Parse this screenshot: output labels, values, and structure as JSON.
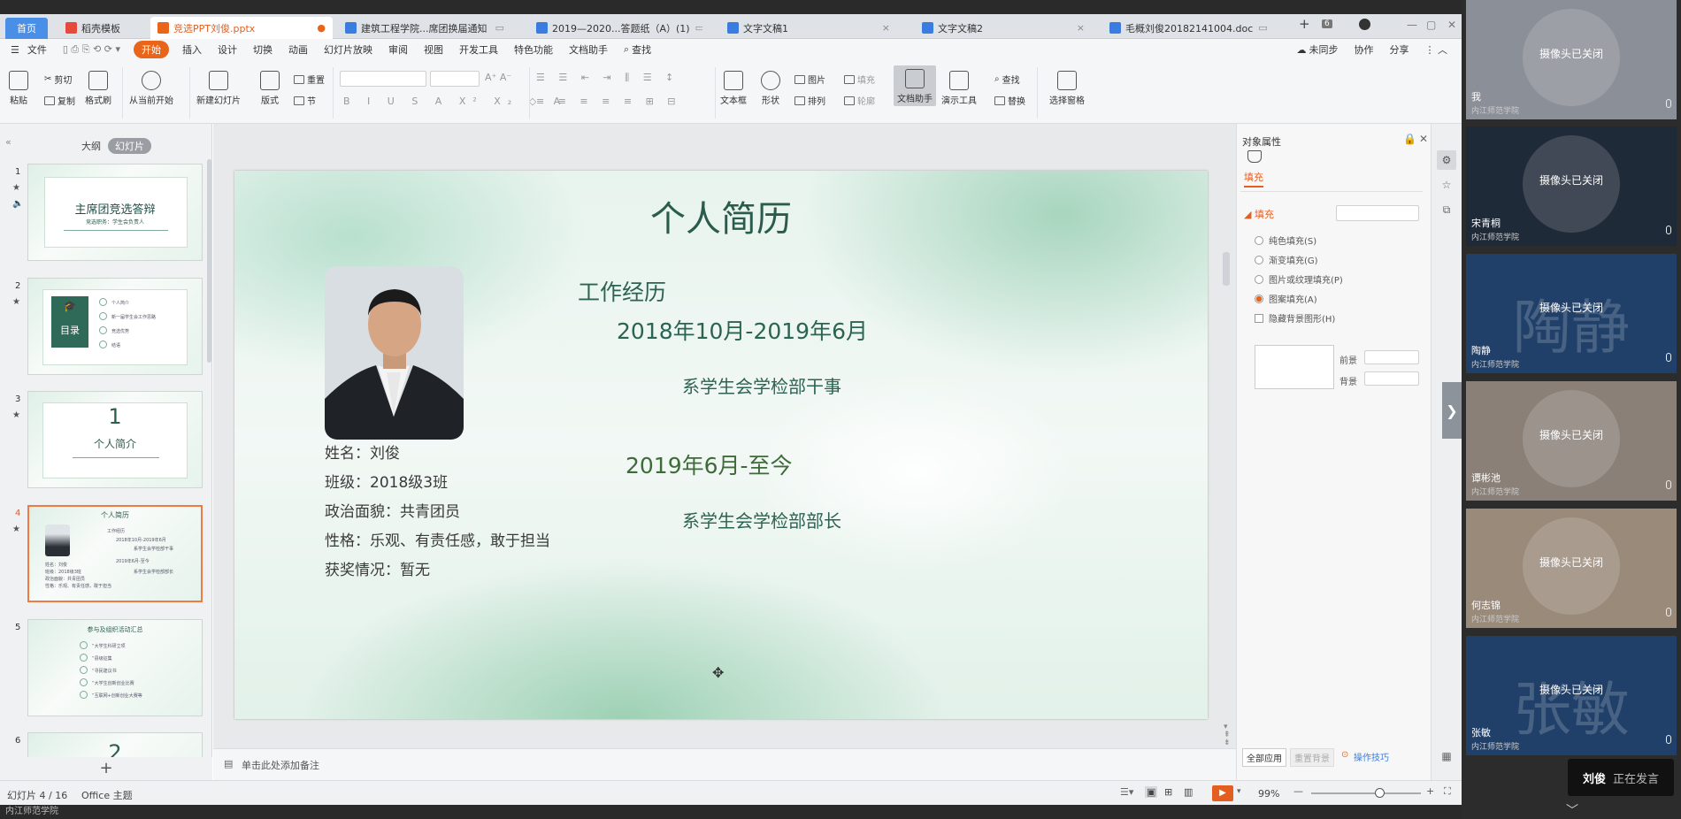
{
  "tabs": [
    {
      "label": "首页",
      "kind": "home"
    },
    {
      "label": "稻壳模板",
      "icon": "docer-icon",
      "color": "#e7493b"
    },
    {
      "label": "竞选PPT刘俊.pptx",
      "icon": "ppt-icon",
      "color": "#e8651a",
      "active": true
    },
    {
      "label": "建筑工程学院...席团换届通知",
      "icon": "word-icon",
      "color": "#3a7de0"
    },
    {
      "label": "2019—2020...答题纸（A）(1)",
      "icon": "word-icon",
      "color": "#3a7de0"
    },
    {
      "label": "文字文稿1",
      "icon": "word-icon",
      "color": "#3a7de0"
    },
    {
      "label": "文字文稿2",
      "icon": "word-icon",
      "color": "#3a7de0"
    },
    {
      "label": "毛概刘俊20182141004.doc",
      "icon": "word-icon",
      "color": "#3a7de0"
    }
  ],
  "tab_count_badge": "6",
  "menu": {
    "file": "文件",
    "items": [
      "开始",
      "插入",
      "设计",
      "切换",
      "动画",
      "幻灯片放映",
      "审阅",
      "视图",
      "开发工具",
      "特色功能",
      "文档助手"
    ],
    "active": "开始",
    "search": "查找",
    "sync": "未同步",
    "collab": "协作",
    "share": "分享"
  },
  "ribbon": {
    "paste": "粘贴",
    "cut": "剪切",
    "copy": "复制",
    "format_painter": "格式刷",
    "play_from": "从当前开始",
    "new_slide": "新建幻灯片",
    "layout": "版式",
    "section": "节",
    "reset": "重置",
    "textbox": "文本框",
    "shape": "形状",
    "picture": "图片",
    "fill": "填充",
    "arrange": "排列",
    "outline": "轮廓",
    "doc_helper": "文档助手",
    "present_tools": "演示工具",
    "find": "查找",
    "replace": "替换",
    "select_pane": "选择窗格"
  },
  "left_panel": {
    "tab_outline": "大纲",
    "tab_slides": "幻灯片",
    "thumbs": [
      {
        "num": "1",
        "title": "主席团竞选答辩",
        "sub": "竞选职务：学生会负责人"
      },
      {
        "num": "2",
        "title": "目录",
        "items": [
          "个人简介",
          "新一届学生会工作思路",
          "竞选优势",
          "结语"
        ]
      },
      {
        "num": "3",
        "title": "1",
        "sub": "个人简介"
      },
      {
        "num": "4",
        "title": "个人简历",
        "selected": true
      },
      {
        "num": "5",
        "title": "参与及组织活动汇总",
        "items": [
          "“大学生科研立项",
          "“县级征集",
          "“寻民建议书",
          "“大学生创新创业比赛",
          "“互联网+创新创业大赛等"
        ]
      },
      {
        "num": "6",
        "title": "2"
      }
    ],
    "add_label": "+"
  },
  "slide": {
    "title": "个人简历",
    "work_heading": "工作经历",
    "period1": "2018年10月-2019年6月",
    "role1": "系学生会学检部干事",
    "period2": "2019年6月-至今",
    "role2": "系学生会学检部部长",
    "info": [
      "姓名：刘俊",
      "班级：2018级3班",
      "政治面貌：共青团员",
      "性格：乐观、有责任感，敢于担当",
      "获奖情况：暂无"
    ]
  },
  "notes_placeholder": "单击此处添加备注",
  "right_panel": {
    "title": "对象属性",
    "tab": "填充",
    "section": "填充",
    "options": [
      {
        "label": "纯色填充(S)",
        "checked": false
      },
      {
        "label": "渐变填充(G)",
        "checked": false
      },
      {
        "label": "图片或纹理填充(P)",
        "checked": false
      },
      {
        "label": "图案填充(A)",
        "checked": true
      }
    ],
    "hide_bg": "隐藏背景图形(H)",
    "foreground": "前景",
    "background": "背景",
    "apply_all": "全部应用",
    "reset_bg": "重置背景",
    "tips": "操作技巧"
  },
  "status": {
    "slide_info": "幻灯片 4 / 16",
    "theme": "Office 主题",
    "zoom": "99%",
    "zoom_fraction": 0.62
  },
  "taskbar_text": "内江师范学院",
  "video": {
    "tiles": [
      {
        "name": "我",
        "status": "摄像头已关闭",
        "school": "内江师范学院",
        "bg": "#8b8f97"
      },
      {
        "name": "宋青桐",
        "status": "摄像头已关闭",
        "school": "内江师范学院",
        "bg": "#1f2a38"
      },
      {
        "name": "陶静",
        "status": "摄像头已关闭",
        "school": "内江师范学院",
        "bg": "#20406a",
        "watermark": "陶静"
      },
      {
        "name": "谭彬池",
        "status": "摄像头已关闭",
        "school": "内江师范学院",
        "bg": "#8a8078"
      },
      {
        "name": "何志锦",
        "status": "摄像头已关闭",
        "school": "内江师范学院",
        "bg": "#9a8a7a"
      },
      {
        "name": "张敏",
        "status": "摄像头已关闭",
        "school": "内江师范学院",
        "bg": "#20406a",
        "watermark": "张敏"
      }
    ],
    "speaker_name": "刘俊",
    "speaker_status": "正在发言"
  }
}
